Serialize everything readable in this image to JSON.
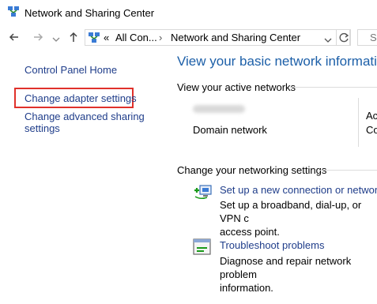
{
  "window": {
    "title": "Network and Sharing Center"
  },
  "nav": {
    "back_icon": "arrow-left-icon",
    "forward_icon": "arrow-right-icon",
    "recent_icon": "chevron-down-icon",
    "up_icon": "arrow-up-icon",
    "overflow": "«",
    "breadcrumbs": [
      "All Con...",
      "Network and Sharing Center"
    ],
    "search_placeholder": "Se"
  },
  "left_pane": {
    "items": [
      {
        "label": "Control Panel Home"
      },
      {
        "label": "Change adapter settings",
        "highlighted": true
      },
      {
        "label": "Change advanced sharing settings",
        "line1": "Change advanced sharing",
        "line2": "settings"
      }
    ]
  },
  "main": {
    "heading": "View your basic network informatio",
    "active_networks": {
      "label": "View your active networks",
      "network_type": "Domain network",
      "right_col_1": "Ac",
      "right_col_2": "Co"
    },
    "networking_settings": {
      "label": "Change your networking settings",
      "tasks": [
        {
          "link": "Set up a new connection or network",
          "desc_line1": "Set up a broadband, dial-up, or VPN c",
          "desc_line2": "access point."
        },
        {
          "link": "Troubleshoot problems",
          "desc_line1": "Diagnose and repair network problem",
          "desc_line2": "information."
        }
      ]
    }
  },
  "colors": {
    "link": "#1f3d8a",
    "heading": "#1c5fa8",
    "highlight": "#e0312b"
  }
}
